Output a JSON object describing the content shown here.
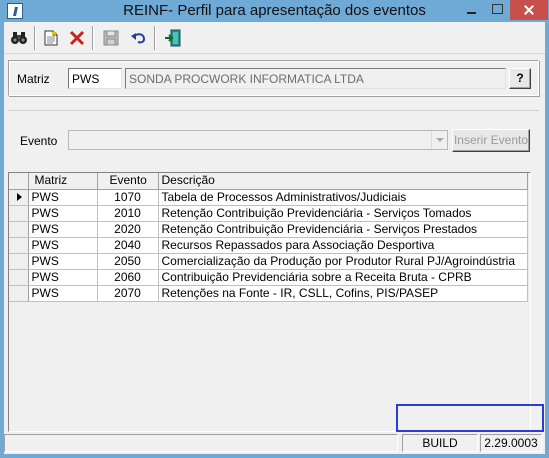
{
  "window": {
    "title": "REINF- Perfil para apresentação dos eventos"
  },
  "toolbar": {
    "buttons": [
      {
        "icon": "binoculars-icon"
      },
      {
        "icon": "new-document-icon"
      },
      {
        "icon": "delete-x-icon"
      },
      {
        "icon": "save-disk-icon"
      },
      {
        "icon": "undo-icon"
      },
      {
        "icon": "exit-door-icon"
      }
    ]
  },
  "header": {
    "matriz_label": "Matriz",
    "matriz_code": "PWS",
    "matriz_name": "SONDA PROCWORK INFORMATICA LTDA",
    "help_label": "?",
    "evento_label": "Evento",
    "evento_value": "",
    "insert_button": "Inserir Evento"
  },
  "grid": {
    "columns": [
      "Matriz",
      "Evento",
      "Descrição"
    ],
    "rows": [
      {
        "matriz": "PWS",
        "evento": "1070",
        "descricao": "Tabela de Processos Administrativos/Judiciais"
      },
      {
        "matriz": "PWS",
        "evento": "2010",
        "descricao": "Retenção Contribuição Previdenciária - Serviços Tomados"
      },
      {
        "matriz": "PWS",
        "evento": "2020",
        "descricao": "Retenção Contribuição Previdenciária - Serviços Prestados"
      },
      {
        "matriz": "PWS",
        "evento": "2040",
        "descricao": "Recursos Repassados para Associação Desportiva"
      },
      {
        "matriz": "PWS",
        "evento": "2050",
        "descricao": "Comercialização da Produção por Produtor Rural PJ/Agroindústria"
      },
      {
        "matriz": "PWS",
        "evento": "2060",
        "descricao": "Contribuição Previdenciária sobre a Receita Bruta - CPRB"
      },
      {
        "matriz": "PWS",
        "evento": "2070",
        "descricao": "Retenções na Fonte - IR, CSLL, Cofins, PIS/PASEP"
      }
    ]
  },
  "status": {
    "build_label": "BUILD",
    "version": "2.29.0003"
  },
  "colors": {
    "titlebar": "#6fa9d6",
    "close": "#c7504a",
    "highlight": "#2d3bd6"
  }
}
